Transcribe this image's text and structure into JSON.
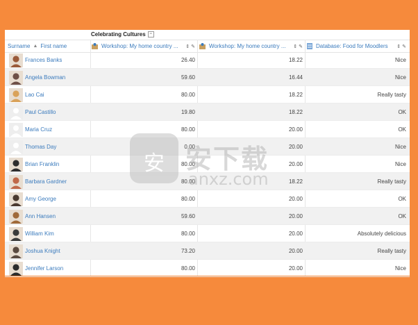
{
  "category": {
    "title": "Celebrating Cultures",
    "collapse_icon": "collapse-icon"
  },
  "headers": {
    "surname": "Surname",
    "firstname": "First name",
    "col1": "Workshop: My home country ...",
    "col2": "Workshop: My home country ...",
    "col3": "Database: Food for Moodlers"
  },
  "watermark": {
    "cn": "安下载",
    "en": "anxz.com"
  },
  "rows": [
    {
      "name": "Frances Banks",
      "g1": "26.40",
      "g2": "18.22",
      "g3": "Nice",
      "avatar": "photo",
      "color": "#9a5a3a"
    },
    {
      "name": "Angela Bowman",
      "g1": "59.60",
      "g2": "16.44",
      "g3": "Nice",
      "avatar": "photo",
      "color": "#6e5047"
    },
    {
      "name": "Lao Cai",
      "g1": "80.00",
      "g2": "18.22",
      "g3": "Really tasty",
      "avatar": "photo",
      "color": "#d9a25a"
    },
    {
      "name": "Paul Castillo",
      "g1": "19.80",
      "g2": "18.22",
      "g3": "OK",
      "avatar": "default",
      "color": "#dcdcdc"
    },
    {
      "name": "Maria Cruz",
      "g1": "80.00",
      "g2": "20.00",
      "g3": "OK",
      "avatar": "default",
      "color": "#dcdcdc"
    },
    {
      "name": "Thomas Day",
      "g1": "0.00",
      "g2": "20.00",
      "g3": "Nice",
      "avatar": "default",
      "color": "#dcdcdc"
    },
    {
      "name": "Brian Franklin",
      "g1": "80.00",
      "g2": "20.00",
      "g3": "Nice",
      "avatar": "photo",
      "color": "#2e2e2e"
    },
    {
      "name": "Barbara Gardner",
      "g1": "80.00",
      "g2": "18.22",
      "g3": "Really tasty",
      "avatar": "photo",
      "color": "#c06848"
    },
    {
      "name": "Amy George",
      "g1": "80.00",
      "g2": "20.00",
      "g3": "OK",
      "avatar": "photo",
      "color": "#4a3a30"
    },
    {
      "name": "Ann Hansen",
      "g1": "59.60",
      "g2": "20.00",
      "g3": "OK",
      "avatar": "photo",
      "color": "#a06a3a"
    },
    {
      "name": "William Kim",
      "g1": "80.00",
      "g2": "20.00",
      "g3": "Absolutely delicious",
      "avatar": "photo",
      "color": "#3a3a3a"
    },
    {
      "name": "Joshua Knight",
      "g1": "73.20",
      "g2": "20.00",
      "g3": "Really tasty",
      "avatar": "photo",
      "color": "#5a4a40"
    },
    {
      "name": "Jennifer Larson",
      "g1": "80.00",
      "g2": "20.00",
      "g3": "Nice",
      "avatar": "photo",
      "color": "#2c2c2c"
    }
  ]
}
